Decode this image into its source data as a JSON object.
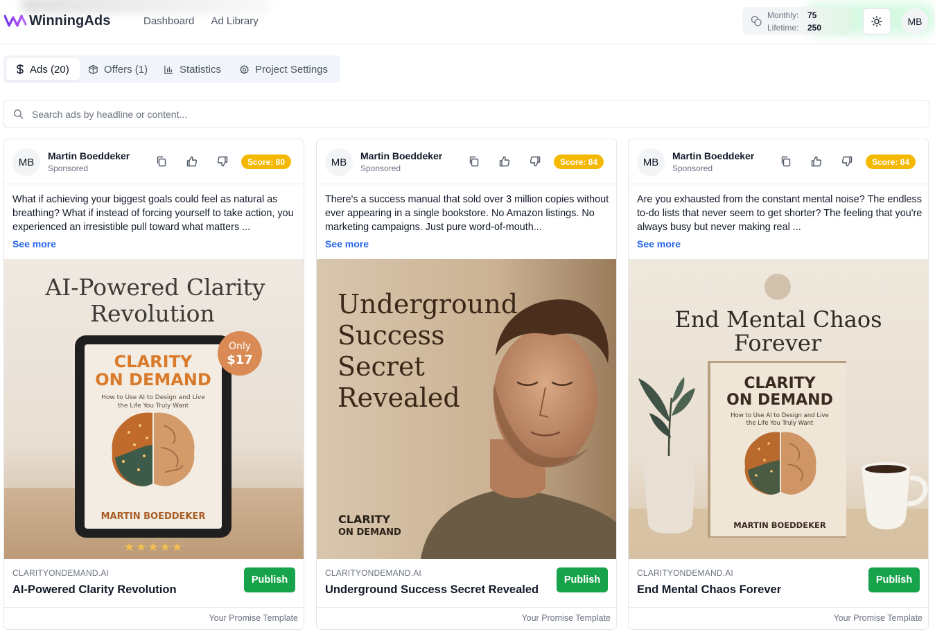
{
  "app": {
    "name": "WinningAds",
    "nav": [
      "Dashboard",
      "Ad Library"
    ],
    "credits": {
      "monthly_label": "Monthly:",
      "monthly_value": "75",
      "lifetime_label": "Lifetime:",
      "lifetime_value": "250"
    },
    "user_initials": "MB"
  },
  "tabs": [
    {
      "label": "Ads (20)",
      "icon": "dollar-icon",
      "active": true
    },
    {
      "label": "Offers (1)",
      "icon": "box-icon",
      "active": false
    },
    {
      "label": "Statistics",
      "icon": "bar-chart-icon",
      "active": false
    },
    {
      "label": "Project Settings",
      "icon": "gear-icon",
      "active": false
    }
  ],
  "search": {
    "placeholder": "Search ads by headline or content...",
    "value": ""
  },
  "colors": {
    "accent": "#16a34a",
    "score": "#f5b800",
    "link": "#2563eb"
  },
  "cards": [
    {
      "initials": "MB",
      "author": "Martin Boeddeker",
      "sponsored": "Sponsored",
      "score": "Score: 80",
      "body": "What if achieving your biggest goals could feel as natural as breathing? What if instead of forcing yourself to take action, you experienced an irresistible pull toward what matters ...",
      "see_more": "See more",
      "creative": {
        "title_line1": "AI-Powered Clarity",
        "title_line2": "Revolution",
        "book_title1": "CLARITY",
        "book_title2": "ON DEMAND",
        "book_subtitle1": "How to Use AI to Design and Live",
        "book_subtitle2": "the Life You Truly Want",
        "book_author": "MARTIN BOEDDEKER",
        "price_line1": "Only",
        "price_line2": "$17",
        "stars": "★★★★★"
      },
      "domain": "CLARITYONDEMAND.AI",
      "headline": "AI-Powered Clarity Revolution",
      "publish": "Publish",
      "template": "Your Promise Template"
    },
    {
      "initials": "MB",
      "author": "Martin Boeddeker",
      "sponsored": "Sponsored",
      "score": "Score: 84",
      "body": "There's a success manual that sold over 3 million copies without ever appearing in a single bookstore. No Amazon listings. No marketing campaigns. Just pure word-of-mouth...",
      "see_more": "See more",
      "creative": {
        "title_line1": "Underground",
        "title_line2": "Success",
        "title_line3": "Secret",
        "title_line4": "Revealed",
        "brand1": "CLARITY",
        "brand2": "ON DEMAND"
      },
      "domain": "CLARITYONDEMAND.AI",
      "headline": "Underground Success Secret Revealed",
      "publish": "Publish",
      "template": "Your Promise Template"
    },
    {
      "initials": "MB",
      "author": "Martin Boeddeker",
      "sponsored": "Sponsored",
      "score": "Score: 84",
      "body": "Are you exhausted from the constant mental noise? The endless to-do lists that never seem to get shorter? The feeling that you're always busy but never making real ...",
      "see_more": "See more",
      "creative": {
        "title_line1": "End Mental Chaos",
        "title_line2": "Forever",
        "book_title1": "CLARITY",
        "book_title2": "ON DEMAND",
        "book_subtitle1": "How to Use AI to Design and Live",
        "book_subtitle2": "the Life You Truly Want",
        "book_author": "MARTIN BOEDDEKER"
      },
      "domain": "CLARITYONDEMAND.AI",
      "headline": "End Mental Chaos Forever",
      "publish": "Publish",
      "template": "Your Promise Template"
    }
  ]
}
